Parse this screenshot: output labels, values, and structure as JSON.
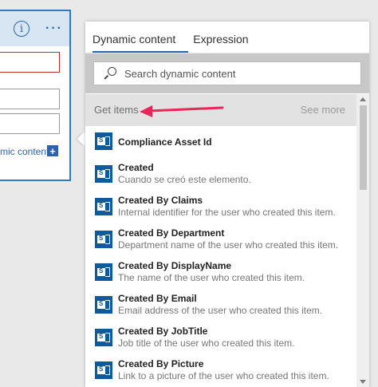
{
  "left_card": {
    "info_glyph": "i",
    "more_glyph": "···",
    "dynamic_link": "mic content",
    "plus_glyph": "+"
  },
  "panel": {
    "tabs": [
      {
        "label": "Dynamic content"
      },
      {
        "label": "Expression"
      }
    ],
    "search": {
      "placeholder": "Search dynamic content"
    },
    "group": {
      "title": "Get items",
      "see_more": "See more"
    },
    "items": [
      {
        "title": "Compliance Asset Id",
        "desc": ""
      },
      {
        "title": "Created",
        "desc": "Cuando se creó este elemento."
      },
      {
        "title": "Created By Claims",
        "desc": "Internal identifier for the user who created this item."
      },
      {
        "title": "Created By Department",
        "desc": "Department name of the user who created this item."
      },
      {
        "title": "Created By DisplayName",
        "desc": "The name of the user who created this item."
      },
      {
        "title": "Created By Email",
        "desc": "Email address of the user who created this item."
      },
      {
        "title": "Created By JobTitle",
        "desc": "Job title of the user who created this item."
      },
      {
        "title": "Created By Picture",
        "desc": "Link to a picture of the user who created this item."
      }
    ]
  },
  "colors": {
    "accent": "#2d62b3",
    "arrow": "#e8265a",
    "item_icon": "#0f5a9b",
    "error_border": "#c02b2b"
  },
  "icons": {
    "info": "info-icon",
    "more": "more-icon",
    "search": "search-icon",
    "item": "sharepoint-icon",
    "arrow": "arrow-left-icon"
  }
}
